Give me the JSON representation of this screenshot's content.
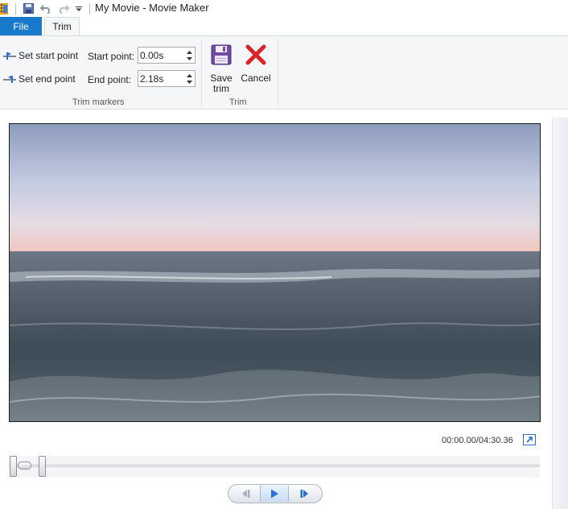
{
  "window": {
    "title": "My Movie - Movie Maker"
  },
  "quick_access": {
    "icons": [
      "app-icon",
      "save-icon",
      "undo-icon",
      "redo-icon",
      "customize-arrow-icon"
    ]
  },
  "tabs": [
    {
      "label": "File",
      "active": false
    },
    {
      "label": "Trim",
      "active": true
    }
  ],
  "ribbon": {
    "trim_markers": {
      "group_label": "Trim markers",
      "set_start_label": "Set start point",
      "set_end_label": "Set end point",
      "start_point_label": "Start point:",
      "start_point_value": "0.00s",
      "end_point_label": "End point:",
      "end_point_value": "2.18s"
    },
    "trim": {
      "group_label": "Trim",
      "save_label_line1": "Save",
      "save_label_line2": "trim",
      "cancel_label": "Cancel"
    }
  },
  "player": {
    "time_readout": "00:00.00/04:30.36",
    "trim_start_fraction": 0.0,
    "trim_end_fraction": 0.055,
    "playhead_fraction": 0.0
  },
  "colors": {
    "file_tab": "#1979ca",
    "cancel_red": "#d9252a",
    "save_purple": "#6f4ba2",
    "play_blue": "#2a6fd6"
  }
}
